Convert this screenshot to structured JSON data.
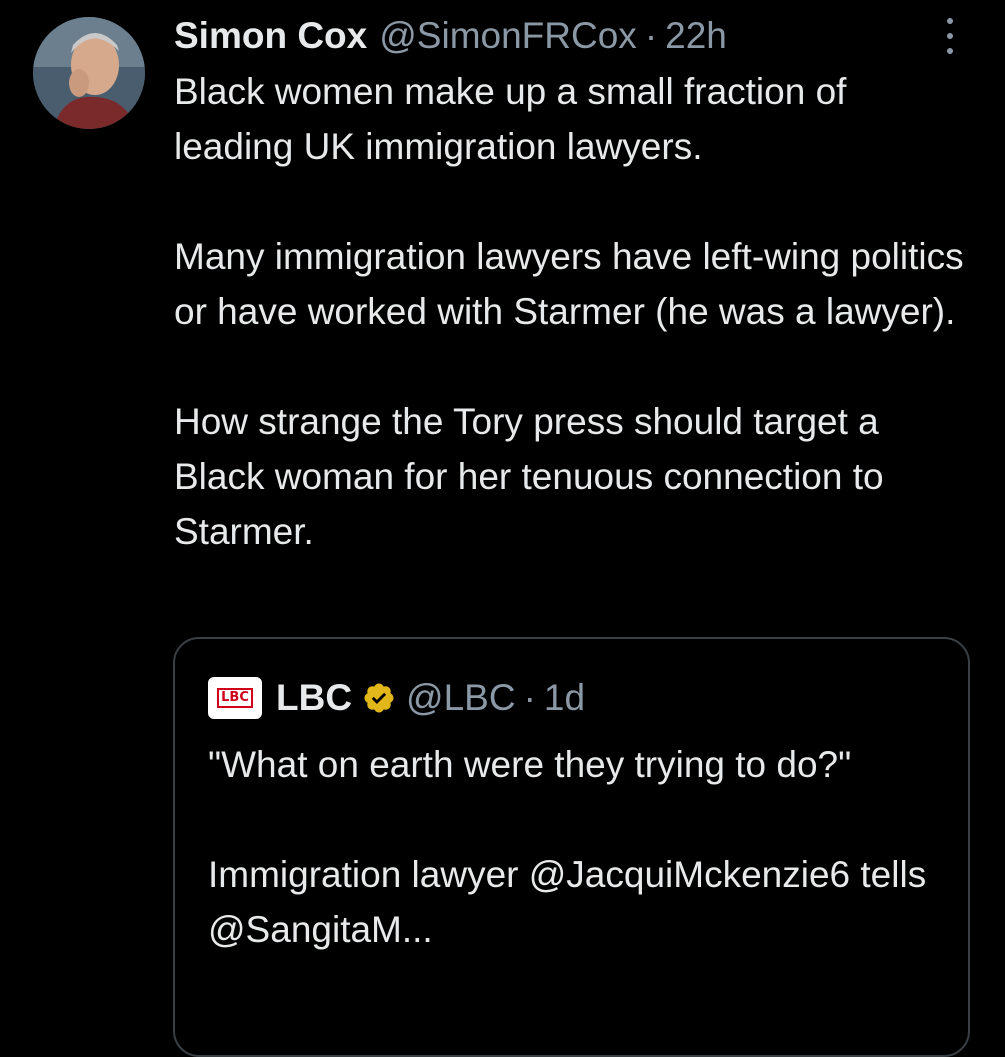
{
  "tweet": {
    "author_name": "Simon Cox",
    "author_handle": "@SimonFRCox",
    "separator": "·",
    "time": "22h",
    "more_icon": "more-vertical-icon",
    "paragraphs": [
      "Black women make up a small fraction of leading UK immigration lawyers.",
      "Many immigration lawyers have left-wing politics or have worked with Starmer (he was a lawyer).",
      "How strange the Tory press should target a Black woman for her tenuous connection to Starmer."
    ]
  },
  "quoted": {
    "logo_text": "LBC",
    "author_name": "LBC",
    "verified_icon": "verified-badge-icon",
    "author_handle": "@LBC",
    "separator": "·",
    "time": "1d",
    "paragraphs": [
      "\"What on earth were they trying to do?\"",
      "Immigration lawyer @JacquiMckenzie6 tells @SangitaM..."
    ]
  },
  "colors": {
    "background": "#000000",
    "primary_text": "#e7e9ea",
    "secondary_text": "#8b98a5",
    "border": "#3a3f44",
    "verified_gold": "#e2b719",
    "lbc_red": "#d0021b"
  }
}
